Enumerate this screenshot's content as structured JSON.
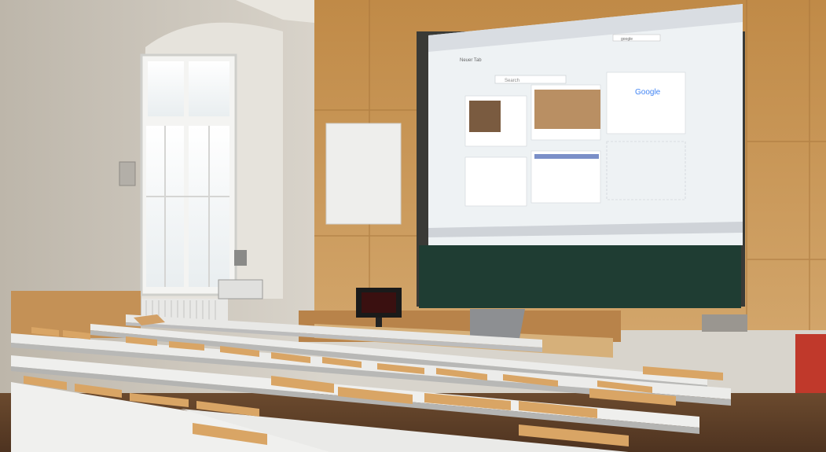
{
  "scene": {
    "description": "",
    "browser": {
      "tab_title": "Neuer Tab",
      "search_placeholder": "Search",
      "address_search": "google",
      "google_logo": "Google"
    },
    "colors": {
      "wall": "#cfcac0",
      "wood": "#c99a5b",
      "chalkboard": "#1f3d33",
      "screen": "#eef2f4",
      "desk": "#e8e8e6"
    }
  }
}
